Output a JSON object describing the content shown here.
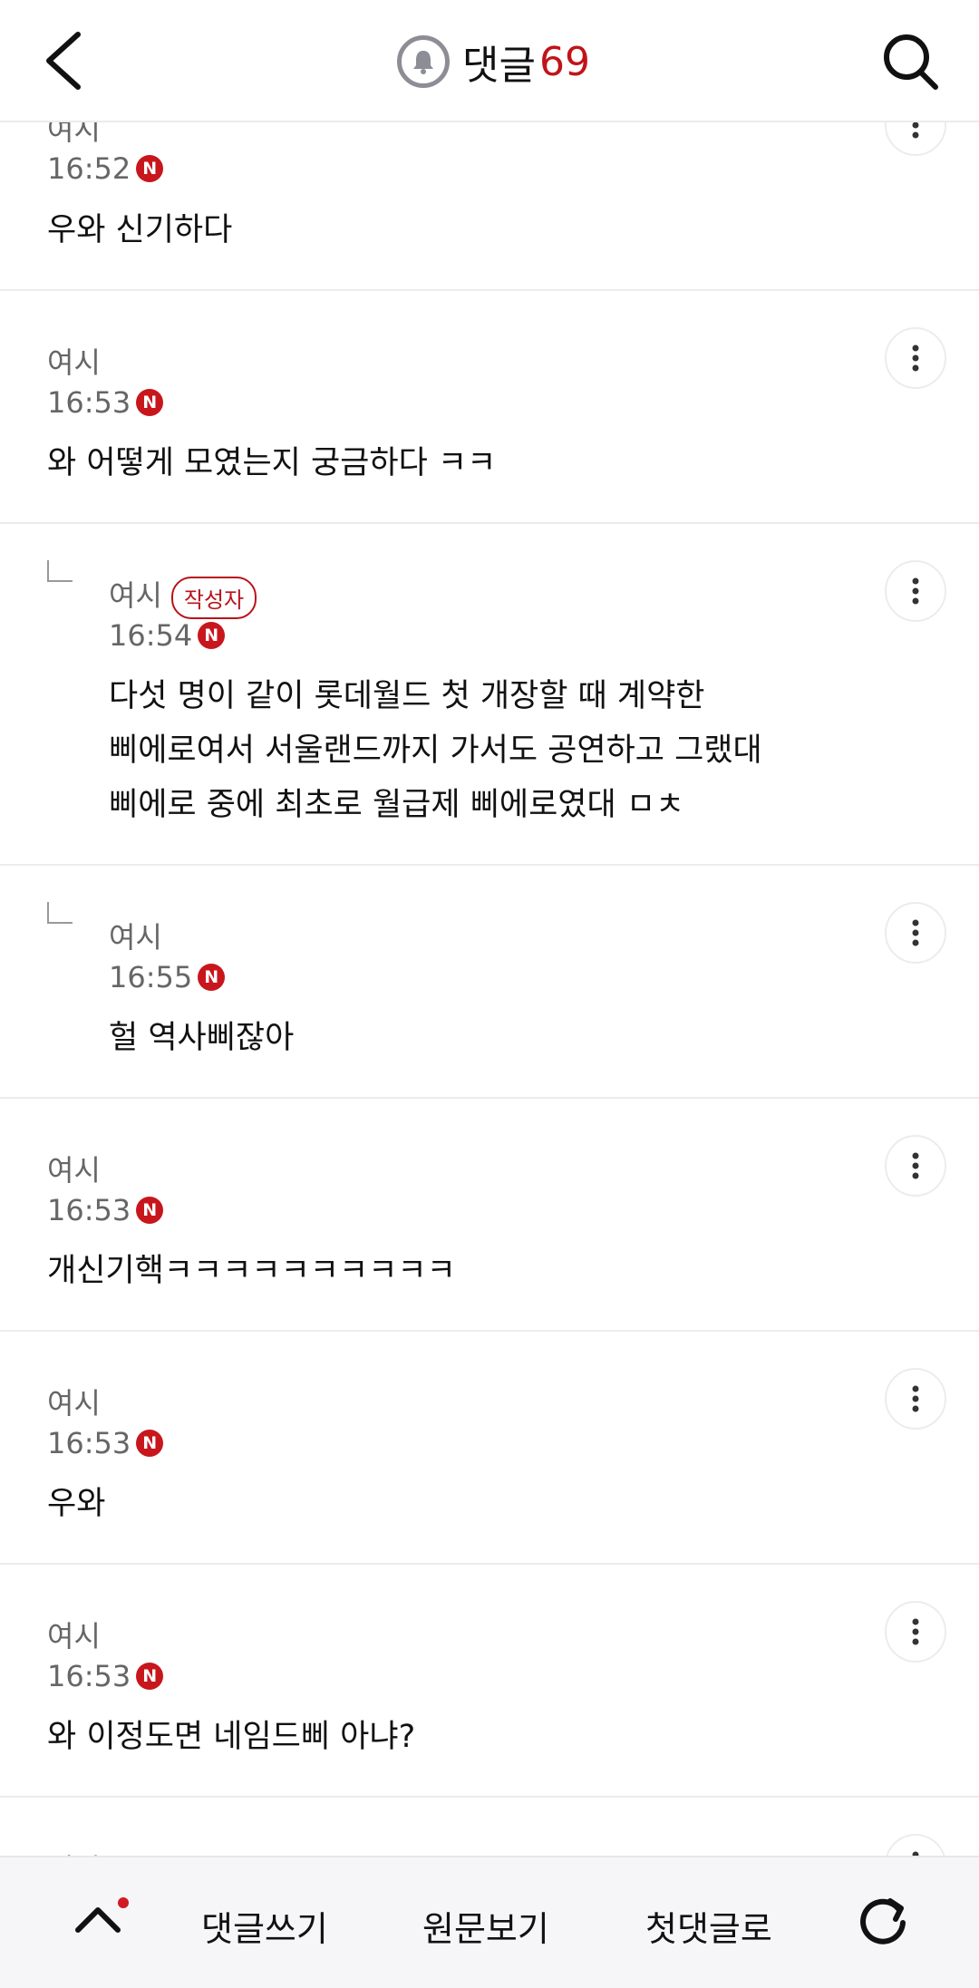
{
  "header": {
    "title": "댓글",
    "count": "69",
    "back_icon": "chevron-left-icon",
    "search_icon": "search-icon",
    "bell_icon": "bell-icon"
  },
  "comments": [
    {
      "author": "여시",
      "time": "16:52",
      "new_badge": "N",
      "body": [
        "우와 신기하다"
      ],
      "reply": false
    },
    {
      "author": "여시",
      "time": "16:53",
      "new_badge": "N",
      "body": [
        "와 어떻게 모였는지 궁금하다 ㅋㅋ"
      ],
      "reply": false
    },
    {
      "author": "여시",
      "author_badge": "작성자",
      "time": "16:54",
      "new_badge": "N",
      "body": [
        "다섯 명이 같이 롯데월드 첫 개장할 때 계약한",
        "삐에로여서 서울랜드까지 가서도 공연하고 그랬대",
        "삐에로 중에 최초로 월급제 삐에로였대 ㅁㅊ"
      ],
      "reply": true
    },
    {
      "author": "여시",
      "time": "16:55",
      "new_badge": "N",
      "body": [
        "헐 역사삐잖아"
      ],
      "reply": true
    },
    {
      "author": "여시",
      "time": "16:53",
      "new_badge": "N",
      "body": [
        "개신기핵ㅋㅋㅋㅋㅋㅋㅋㅋㅋㅋ"
      ],
      "reply": false
    },
    {
      "author": "여시",
      "time": "16:53",
      "new_badge": "N",
      "body": [
        "우와"
      ],
      "reply": false
    },
    {
      "author": "여시",
      "time": "16:53",
      "new_badge": "N",
      "body": [
        "와 이정도면 네임드삐 아냐?"
      ],
      "reply": false
    },
    {
      "author": "여시",
      "time": "",
      "new_badge": "",
      "body": [],
      "reply": false
    }
  ],
  "bottom_bar": {
    "up_icon": "chevron-up-icon",
    "write_label": "댓글쓰기",
    "original_label": "원문보기",
    "first_label": "첫댓글로",
    "refresh_icon": "refresh-icon"
  },
  "colors": {
    "accent": "#c0141a",
    "muted_text": "#666666",
    "divider": "#ececec"
  }
}
